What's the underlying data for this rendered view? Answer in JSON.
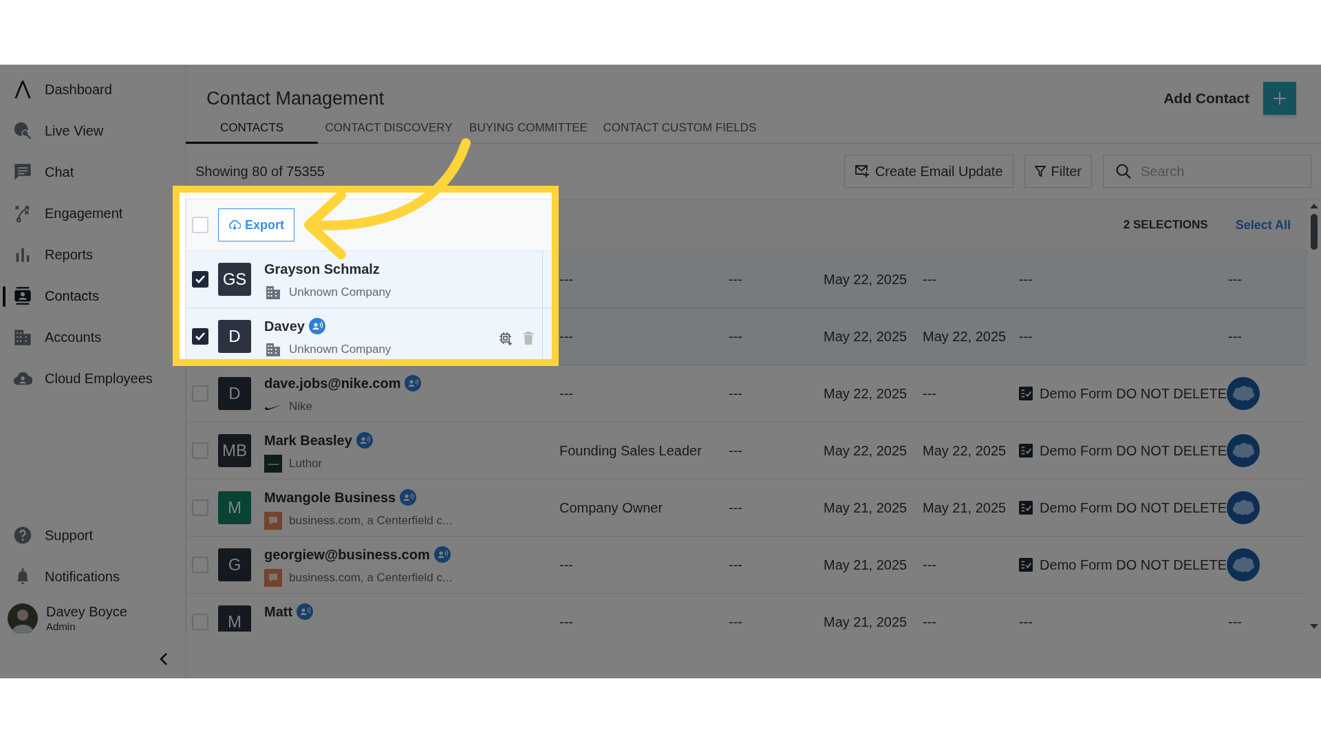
{
  "sidebar": {
    "items": [
      {
        "label": "Dashboard",
        "selected": false
      },
      {
        "label": "Live View",
        "selected": false
      },
      {
        "label": "Chat",
        "selected": false
      },
      {
        "label": "Engagement",
        "selected": false
      },
      {
        "label": "Reports",
        "selected": false
      },
      {
        "label": "Contacts",
        "selected": true
      },
      {
        "label": "Accounts",
        "selected": false
      },
      {
        "label": "Cloud Employees",
        "selected": false
      }
    ],
    "footer_items": [
      {
        "label": "Support"
      },
      {
        "label": "Notifications"
      }
    ],
    "user": {
      "name": "Davey Boyce",
      "role": "Admin"
    }
  },
  "header": {
    "title": "Contact Management",
    "add_label": "Add Contact"
  },
  "tabs": [
    {
      "label": "CONTACTS",
      "selected": true
    },
    {
      "label": "CONTACT DISCOVERY",
      "selected": false
    },
    {
      "label": "BUYING COMMITTEE",
      "selected": false
    },
    {
      "label": "CONTACT CUSTOM FIELDS",
      "selected": false
    }
  ],
  "toolbar": {
    "count_text": "Showing 80 of 75355",
    "buttons": [
      {
        "kind": "email",
        "label": "Create Email Update"
      },
      {
        "kind": "filter",
        "label": "Filter"
      }
    ],
    "search": {
      "placeholder": "Search"
    }
  },
  "table": {
    "select_all_checked": false,
    "export_label": "Export",
    "selection_count": "2 SELECTIONS",
    "select_all_label": "Select All",
    "rows": [
      {
        "selected": true,
        "initials": "GS",
        "name": "Grayson Schmalz",
        "badge": false,
        "company": {
          "kind": "building",
          "name": "Unknown Company"
        },
        "actions": false,
        "column_2": "---",
        "column_3": "---",
        "column_4": "May 22, 2025",
        "column_5": "---",
        "column_6": {
          "kind": "text",
          "text": "---"
        },
        "column_7": {
          "kind": "text",
          "text": "---"
        }
      },
      {
        "selected": true,
        "initials": "D",
        "name": "Davey",
        "badge": true,
        "company": {
          "kind": "building",
          "name": "Unknown Company"
        },
        "actions": true,
        "column_2": "---",
        "column_3": "---",
        "column_4": "May 22, 2025",
        "column_5": "May 22, 2025",
        "column_6": {
          "kind": "text",
          "text": "---"
        },
        "column_7": {
          "kind": "text",
          "text": "---"
        }
      },
      {
        "selected": false,
        "initials": "D",
        "name": "dave.jobs@nike.com",
        "badge": true,
        "company": {
          "kind": "swoosh",
          "name": "Nike"
        },
        "actions": false,
        "column_2": "---",
        "column_3": "---",
        "column_4": "May 22, 2025",
        "column_5": "---",
        "column_6": {
          "kind": "form",
          "text": "Demo Form DO NOT DELETE"
        },
        "column_7": {
          "kind": "salesforce"
        }
      },
      {
        "selected": false,
        "initials": "MB",
        "name": "Mark Beasley",
        "badge": true,
        "company": {
          "kind": "square",
          "name": "Luthor"
        },
        "actions": false,
        "column_2": "Founding Sales Leader",
        "column_3": "---",
        "column_4": "May 22, 2025",
        "column_5": "May 22, 2025",
        "column_6": {
          "kind": "form",
          "text": "Demo Form DO NOT DELETE"
        },
        "column_7": {
          "kind": "salesforce"
        }
      },
      {
        "selected": false,
        "initials": "M",
        "name": "Mwangole Business",
        "badge": true,
        "company": {
          "kind": "bubble",
          "name": "business.com, a Centerfield c..."
        },
        "actions": false,
        "column_2": "Company Owner",
        "column_3": "---",
        "column_4": "May 21, 2025",
        "column_5": "May 21, 2025",
        "column_6": {
          "kind": "form",
          "text": "Demo Form DO NOT DELETE"
        },
        "column_7": {
          "kind": "salesforce"
        }
      },
      {
        "selected": false,
        "initials": "G",
        "name": "georgiew@business.com",
        "badge": true,
        "company": {
          "kind": "bubble",
          "name": "business.com, a Centerfield c..."
        },
        "actions": false,
        "column_2": "---",
        "column_3": "---",
        "column_4": "May 21, 2025",
        "column_5": "---",
        "column_6": {
          "kind": "form",
          "text": "Demo Form DO NOT DELETE"
        },
        "column_7": {
          "kind": "salesforce"
        }
      },
      {
        "selected": false,
        "initials": "M",
        "name": "Matt",
        "badge": true,
        "actions": false,
        "column_2": "---",
        "column_3": "---",
        "column_4": "May 21, 2025",
        "column_5": "---",
        "column_6": {
          "kind": "text",
          "text": "---"
        },
        "column_7": {
          "kind": "text",
          "text": "---"
        }
      }
    ]
  }
}
